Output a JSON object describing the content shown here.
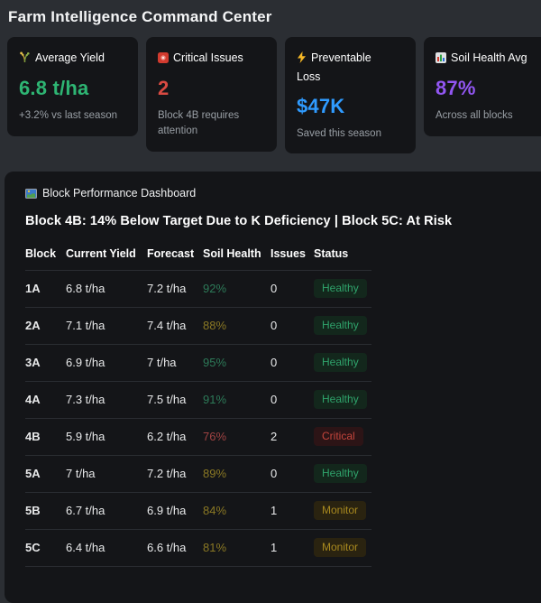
{
  "page_title": "Farm Intelligence Command Center",
  "stat_cards": [
    {
      "icon": "wheat-icon",
      "label": "Average Yield",
      "value": "6.8 t/ha",
      "value_color": "#2eb573",
      "subtitle": "+3.2% vs last season"
    },
    {
      "icon": "siren-icon",
      "label": "Critical Issues",
      "value": "2",
      "value_color": "#d94a42",
      "subtitle": "Block 4B requires attention"
    },
    {
      "icon": "lightning-icon",
      "label": "Preventable Loss",
      "value": "$47K",
      "value_color": "#2f9bff",
      "subtitle": "Saved this season"
    },
    {
      "icon": "bar-chart-icon",
      "label": "Soil Health Avg",
      "value": "87%",
      "value_color": "#9256f2",
      "subtitle": "Across all blocks"
    }
  ],
  "dashboard": {
    "section_icon": "map-icon",
    "section_label": "Block Performance Dashboard",
    "headline": "Block 4B: 14% Below Target Due to K Deficiency | Block 5C: At Risk",
    "table": {
      "columns": [
        "Block",
        "Current Yield",
        "Forecast",
        "Soil Health",
        "Issues",
        "Status"
      ],
      "rows": [
        {
          "block": "1A",
          "current_yield": "6.8 t/ha",
          "forecast": "7.2 t/ha",
          "soil_health": "92%",
          "soil_level": "good",
          "issues": "0",
          "status": "Healthy"
        },
        {
          "block": "2A",
          "current_yield": "7.1 t/ha",
          "forecast": "7.4 t/ha",
          "soil_health": "88%",
          "soil_level": "warn",
          "issues": "0",
          "status": "Healthy"
        },
        {
          "block": "3A",
          "current_yield": "6.9 t/ha",
          "forecast": "7 t/ha",
          "soil_health": "95%",
          "soil_level": "good",
          "issues": "0",
          "status": "Healthy"
        },
        {
          "block": "4A",
          "current_yield": "7.3 t/ha",
          "forecast": "7.5 t/ha",
          "soil_health": "91%",
          "soil_level": "good",
          "issues": "0",
          "status": "Healthy"
        },
        {
          "block": "4B",
          "current_yield": "5.9 t/ha",
          "forecast": "6.2 t/ha",
          "soil_health": "76%",
          "soil_level": "bad",
          "issues": "2",
          "status": "Critical"
        },
        {
          "block": "5A",
          "current_yield": "7 t/ha",
          "forecast": "7.2 t/ha",
          "soil_health": "89%",
          "soil_level": "warn",
          "issues": "0",
          "status": "Healthy"
        },
        {
          "block": "5B",
          "current_yield": "6.7 t/ha",
          "forecast": "6.9 t/ha",
          "soil_health": "84%",
          "soil_level": "warn",
          "issues": "1",
          "status": "Monitor"
        },
        {
          "block": "5C",
          "current_yield": "6.4 t/ha",
          "forecast": "6.6 t/ha",
          "soil_health": "81%",
          "soil_level": "warn",
          "issues": "1",
          "status": "Monitor"
        }
      ]
    }
  },
  "colors": {
    "page_bg": "#2b2e33",
    "card_bg": "#141518",
    "healthy_green": "#2fa36b",
    "critical_red": "#c4453c",
    "monitor_yellow": "#a8891f"
  }
}
